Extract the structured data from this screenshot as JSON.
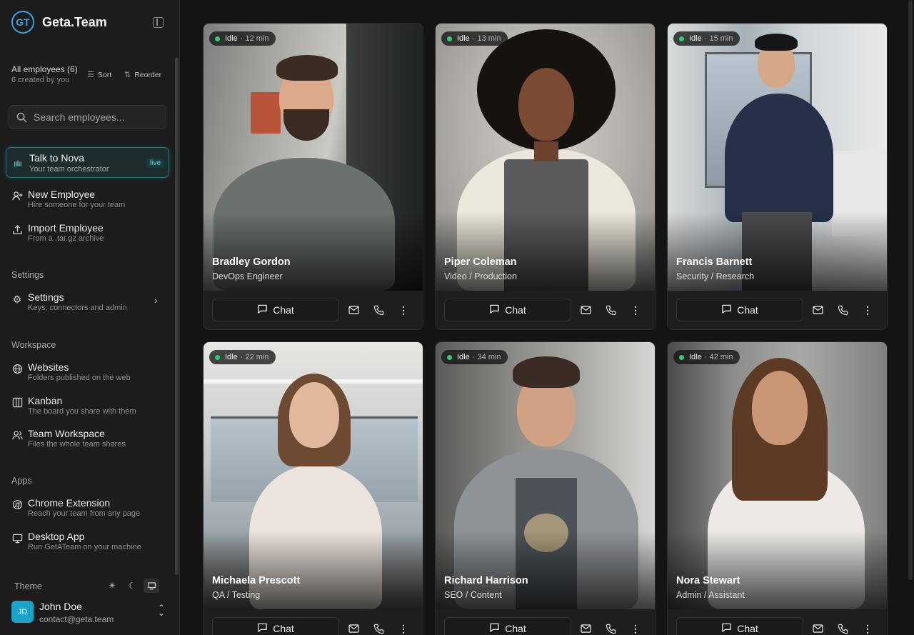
{
  "brand": {
    "logo_text": "GT",
    "name": "Geta.Team"
  },
  "employees_header": {
    "title": "All employees (6)",
    "subtitle": "6 created by you",
    "sort_label": "Sort",
    "reorder_label": "Reorder"
  },
  "search": {
    "placeholder": "Search employees..."
  },
  "nova": {
    "label": "Talk to Nova",
    "sub": "Your team orchestrator",
    "badge": "live"
  },
  "actions": [
    {
      "label": "New Employee",
      "sub": "Hire someone for your team",
      "icon": "user-plus-icon"
    },
    {
      "label": "Import Employee",
      "sub": "From a .tar.gz archive",
      "icon": "upload-icon"
    }
  ],
  "settings_section": {
    "heading": "Settings",
    "item": {
      "label": "Settings",
      "sub": "Keys, connectors and admin",
      "icon": "gear-icon"
    }
  },
  "workspace_section": {
    "heading": "Workspace",
    "items": [
      {
        "label": "Websites",
        "sub": "Folders published on the web",
        "icon": "globe-icon"
      },
      {
        "label": "Kanban",
        "sub": "The board you share with them",
        "icon": "columns-icon"
      },
      {
        "label": "Team Workspace",
        "sub": "Files the whole team shares",
        "icon": "users-icon"
      }
    ]
  },
  "apps_section": {
    "heading": "Apps",
    "items": [
      {
        "label": "Chrome Extension",
        "sub": "Reach your team from any page",
        "icon": "chrome-icon"
      },
      {
        "label": "Desktop App",
        "sub": "Run GetATeam on your machine",
        "icon": "monitor-icon"
      }
    ]
  },
  "theme": {
    "label": "Theme",
    "options": [
      "light",
      "dark",
      "system"
    ],
    "selected": "system"
  },
  "user": {
    "initials": "JD",
    "name": "John Doe",
    "email": "contact@geta.team"
  },
  "colors": {
    "accent": "#3aa0e0",
    "status_idle": "#2ecc71",
    "nova_border": "#2d6f72"
  },
  "employees": [
    {
      "name": "Bradley Gordon",
      "role": "DevOps Engineer",
      "status": "Idle",
      "minutes": "· 12 min",
      "chat_label": "Chat"
    },
    {
      "name": "Piper Coleman",
      "role": "Video / Production",
      "status": "Idle",
      "minutes": "· 13 min",
      "chat_label": "Chat"
    },
    {
      "name": "Francis Barnett",
      "role": "Security / Research",
      "status": "Idle",
      "minutes": "· 15 min",
      "chat_label": "Chat"
    },
    {
      "name": "Michaela Prescott",
      "role": "QA / Testing",
      "status": "Idle",
      "minutes": "· 22 min",
      "chat_label": "Chat"
    },
    {
      "name": "Richard Harrison",
      "role": "SEO / Content",
      "status": "Idle",
      "minutes": "· 34 min",
      "chat_label": "Chat"
    },
    {
      "name": "Nora Stewart",
      "role": "Admin / Assistant",
      "status": "Idle",
      "minutes": "· 42 min",
      "chat_label": "Chat"
    }
  ]
}
